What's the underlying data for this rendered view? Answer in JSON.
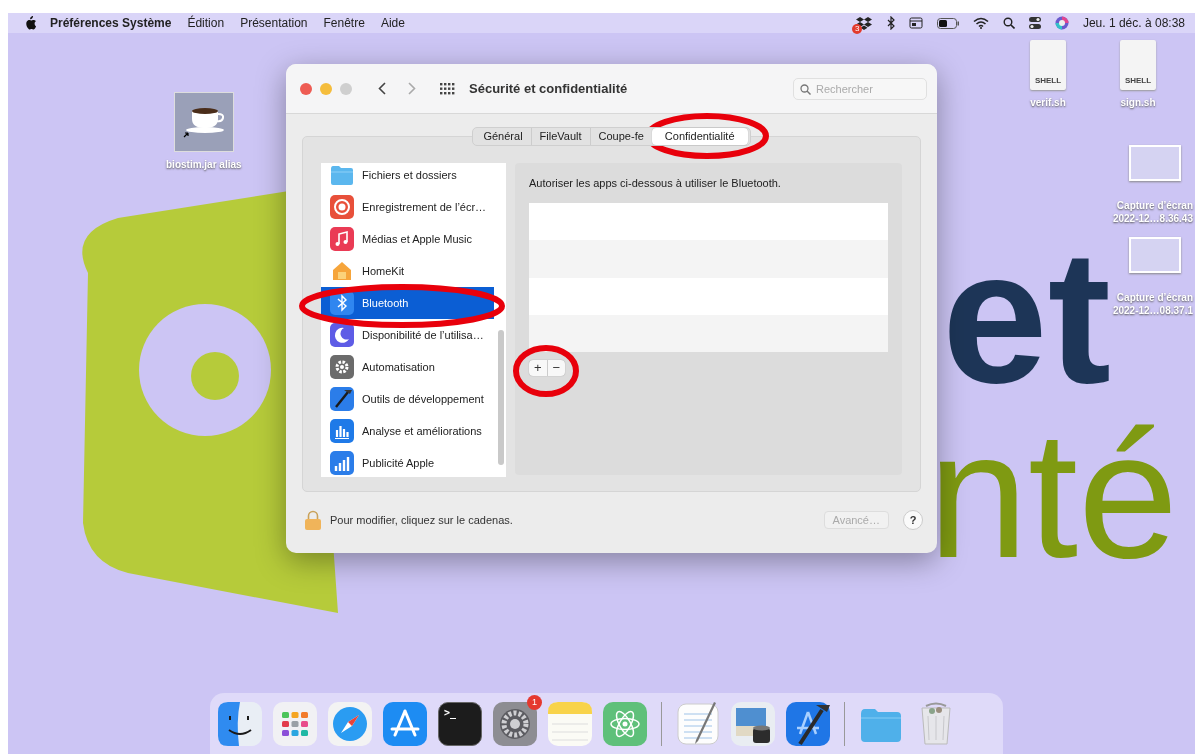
{
  "menu_bar": {
    "app_name": "Préférences Système",
    "menus": [
      "Édition",
      "Présentation",
      "Fenêtre",
      "Aide"
    ],
    "status_icons": [
      {
        "kind": "dropbox",
        "badge": "3"
      },
      {
        "kind": "bluetooth"
      },
      {
        "kind": "window"
      },
      {
        "kind": "battery"
      },
      {
        "kind": "wifi"
      },
      {
        "kind": "search"
      },
      {
        "kind": "control"
      },
      {
        "kind": "siri"
      }
    ],
    "clock": "Jeu. 1 déc. à 08:38"
  },
  "wallpaper": {
    "line_1": "et",
    "line_2": "nté"
  },
  "desktop_icons": [
    {
      "kind": "java",
      "lines": [
        "biostim.jar alias"
      ]
    },
    {
      "kind": "shell",
      "tag": "SHELL",
      "lines": [
        "verif.sh"
      ]
    },
    {
      "kind": "shell",
      "tag": "SHELL",
      "lines": [
        "sign.sh"
      ]
    },
    {
      "kind": "screenshot",
      "lines": [
        "Capture d’écran",
        "2022-12…8.36.43"
      ]
    },
    {
      "kind": "screenshot",
      "lines": [
        "Capture d’écran",
        "2022-12…08.37.1"
      ]
    }
  ],
  "window": {
    "title": "Sécurité et confidentialité",
    "search": {
      "placeholder": "Rechercher"
    },
    "tabs": [
      {
        "label": "Général",
        "selected": false
      },
      {
        "label": "FileVault",
        "selected": false
      },
      {
        "label": "Coupe-fe",
        "selected": false
      },
      {
        "label": "Confidentialité",
        "selected": true
      }
    ],
    "sidebar": {
      "items": [
        {
          "label": "Fichiers et dossiers",
          "kind": "folder",
          "selected": false
        },
        {
          "label": "Enregistrement de l’écr…",
          "kind": "record",
          "selected": false
        },
        {
          "label": "Médias et Apple Music",
          "kind": "music",
          "selected": false
        },
        {
          "label": "HomeKit",
          "kind": "home",
          "selected": false
        },
        {
          "label": "Bluetooth",
          "kind": "bluetooth",
          "selected": true
        },
        {
          "label": "Disponibilité de l’utilisa…",
          "kind": "moon",
          "selected": false
        },
        {
          "label": "Automatisation",
          "kind": "gear",
          "selected": false
        },
        {
          "label": "Outils de développement",
          "kind": "tools",
          "selected": false
        },
        {
          "label": "Analyse et améliorations",
          "kind": "bars",
          "selected": false
        },
        {
          "label": "Publicité Apple",
          "kind": "ads",
          "selected": false
        }
      ]
    },
    "pane": {
      "description": "Autoriser les apps ci-dessous à utiliser le Bluetooth.",
      "add": "+",
      "remove": "−"
    },
    "footer": {
      "lock_text": "Pour modifier, cliquez sur le cadenas.",
      "advanced": {
        "label": "Avancé…",
        "disabled": true
      },
      "help": "?"
    }
  },
  "dock": [
    {
      "kind": "finder"
    },
    {
      "kind": "launchpad"
    },
    {
      "kind": "safari"
    },
    {
      "kind": "appstore"
    },
    {
      "kind": "terminal",
      "glyph": ">_"
    },
    {
      "kind": "settings",
      "badge": "1"
    },
    {
      "kind": "notes"
    },
    {
      "kind": "atom"
    },
    {
      "kind": "separator"
    },
    {
      "kind": "textedit"
    },
    {
      "kind": "preview"
    },
    {
      "kind": "xcode"
    },
    {
      "kind": "separator"
    },
    {
      "kind": "folder"
    },
    {
      "kind": "trash"
    }
  ]
}
